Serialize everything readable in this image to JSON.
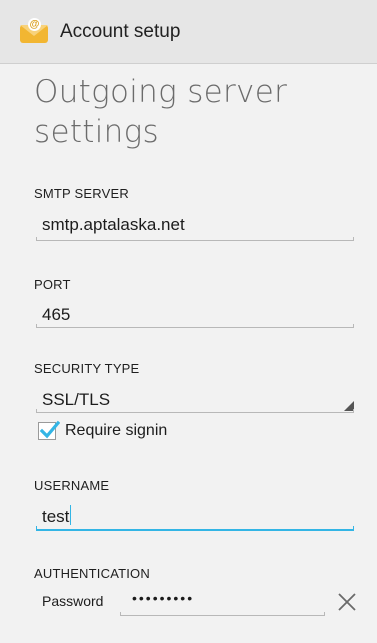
{
  "actionbar": {
    "title": "Account setup"
  },
  "page": {
    "title": "Outgoing server settings"
  },
  "smtp_server": {
    "label": "SMTP SERVER",
    "value": "smtp.aptalaska.net"
  },
  "port": {
    "label": "PORT",
    "value": "465"
  },
  "security_type": {
    "label": "SECURITY TYPE",
    "selected": "SSL/TLS"
  },
  "require_signin": {
    "label": "Require signin",
    "checked": true
  },
  "username": {
    "label": "USERNAME",
    "value": "test"
  },
  "authentication": {
    "label": "AUTHENTICATION",
    "method_label": "Password",
    "masked_value": "•••••••••"
  },
  "icons": {
    "app": "email-app-icon",
    "check": "check-icon",
    "dropdown": "spinner-triangle-icon",
    "clear": "close-icon"
  },
  "colors": {
    "accent": "#33b5e5",
    "checkbox": "#33b5e5",
    "app_icon": "#f2b632"
  }
}
